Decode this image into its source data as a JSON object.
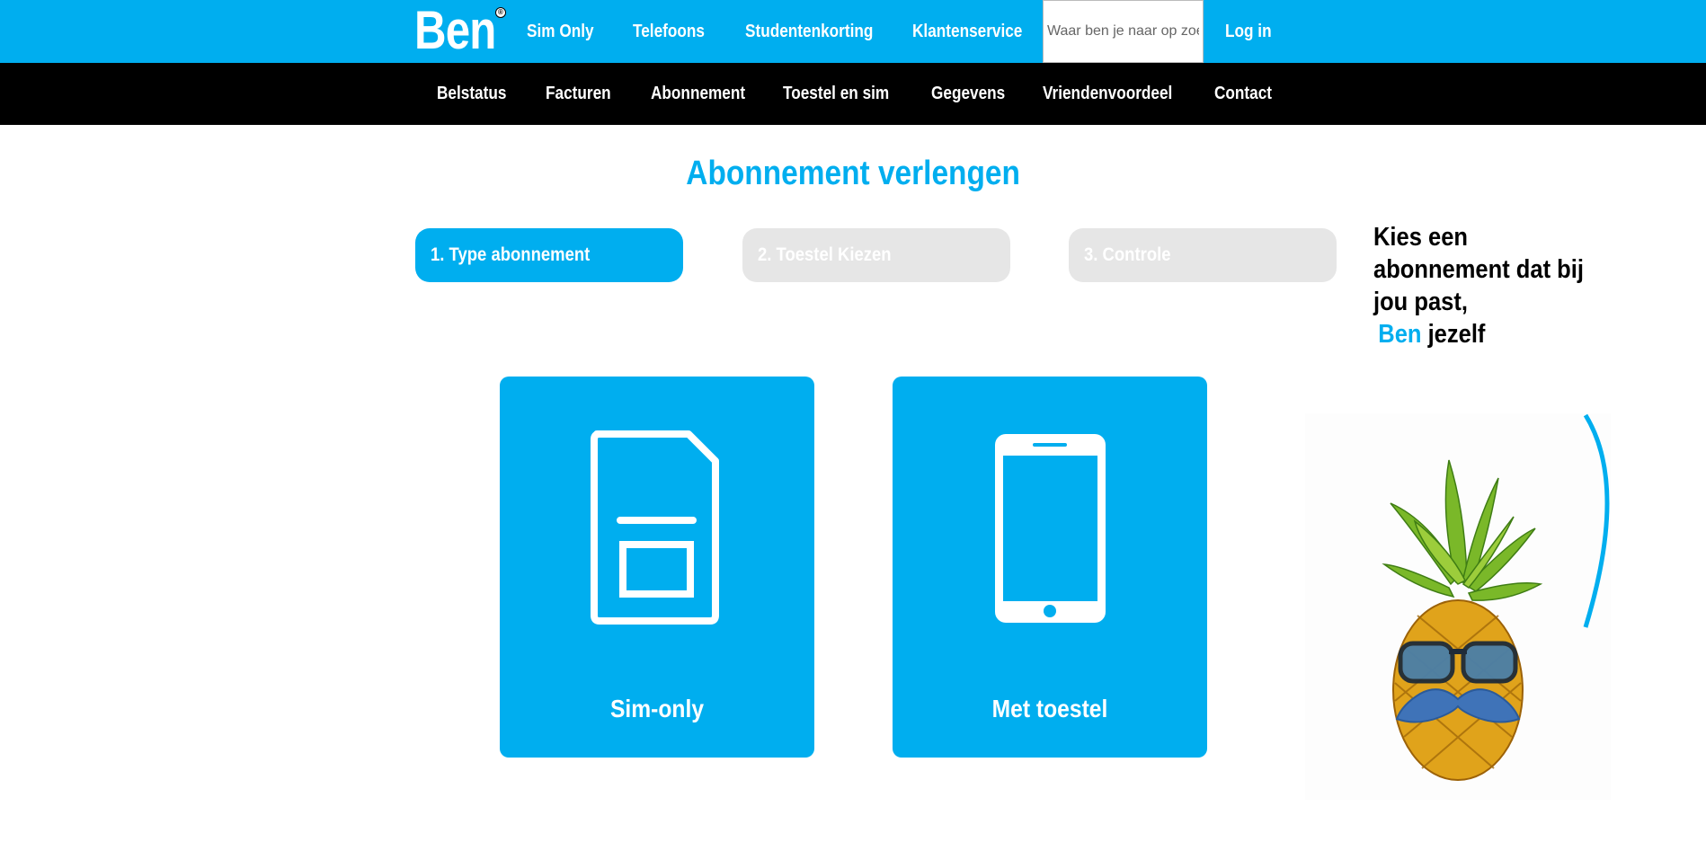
{
  "brand": {
    "logo_text": "Ben",
    "registered_mark": "®"
  },
  "top_nav": {
    "items": [
      "Sim Only",
      "Telefoons",
      "Studentenkorting",
      "Klantenservice"
    ],
    "search_placeholder": "Waar ben je naar op zoek?",
    "login_label": "Log in"
  },
  "sub_nav": {
    "items": [
      "Belstatus",
      "Facturen",
      "Abonnement",
      "Toestel en sim",
      "Gegevens",
      "Vriendenvoordeel",
      "Contact"
    ]
  },
  "page": {
    "title": "Abonnement verlengen"
  },
  "steps": [
    {
      "label": "1. Type abonnement",
      "state": "active"
    },
    {
      "label": "2. Toestel Kiezen",
      "state": "inactive"
    },
    {
      "label": "3. Controle",
      "state": "inactive"
    }
  ],
  "options": [
    {
      "label": "Sim-only",
      "icon": "sim-card-icon"
    },
    {
      "label": "Met toestel",
      "icon": "smartphone-icon"
    }
  ],
  "promo": {
    "line1": "Kies een",
    "line2": "abonnement dat bij",
    "line3": "jou past,",
    "brand_word": "Ben",
    "last_word": "jezelf"
  },
  "colors": {
    "accent": "#00aeef",
    "subnav_bg": "#000000",
    "inactive_step": "#e6e6e6"
  }
}
